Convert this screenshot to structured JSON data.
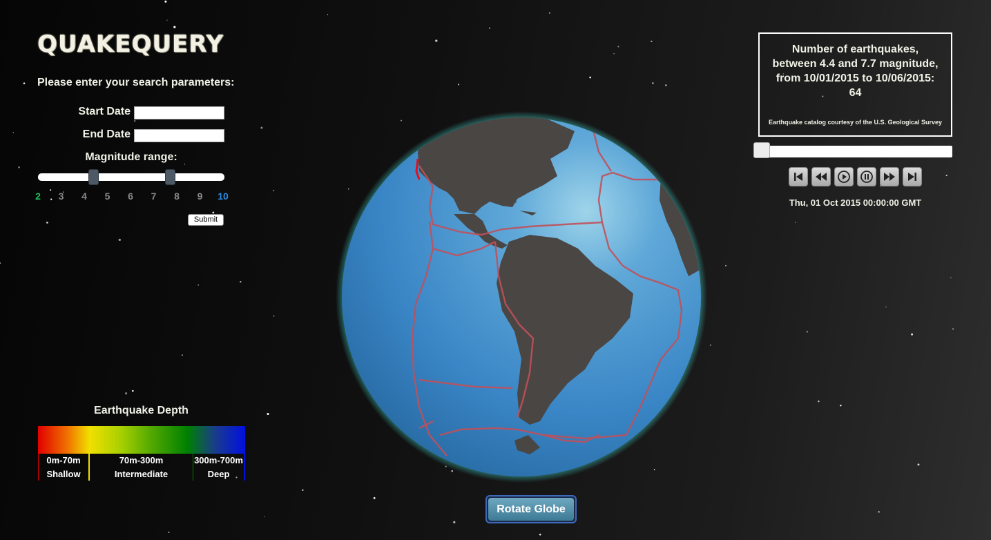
{
  "app": {
    "title": "QUAKEQUERY"
  },
  "search": {
    "prompt": "Please enter your search parameters:",
    "start_label": "Start Date",
    "end_label": "End Date",
    "start_value": "",
    "end_value": "",
    "magnitude_label": "Magnitude range:",
    "magnitude_min": 2,
    "magnitude_max": 10,
    "selected_low": 4.4,
    "selected_high": 7.7,
    "ticks": [
      "2",
      "3",
      "4",
      "5",
      "6",
      "7",
      "8",
      "9",
      "10"
    ],
    "submit_label": "Submit"
  },
  "legend": {
    "title": "Earthquake Depth",
    "segments": [
      {
        "range": "0m-70m",
        "name": "Shallow",
        "color": "#e00000"
      },
      {
        "range": "70m-300m",
        "name": "Intermediate",
        "color": "#f0e000"
      },
      {
        "range": "300m-700m",
        "name": "Deep",
        "color": "#0010e0"
      }
    ]
  },
  "info": {
    "line1": "Number of earthquakes,",
    "line2": "between 4.4 and 7.7 magnitude,",
    "line3": "from 10/01/2015 to 10/06/2015:",
    "count": "64",
    "credit": "Earthquake catalog courtesy of the U.S. Geological Survey"
  },
  "timeline": {
    "position": 0,
    "current_time": "Thu, 01 Oct 2015 00:00:00 GMT",
    "controls": [
      "skip-start-icon",
      "rewind-icon",
      "play-icon",
      "pause-icon",
      "fast-forward-icon",
      "skip-end-icon"
    ]
  },
  "globe": {
    "ocean_color": "#3a86c6",
    "land_color": "#4a4644",
    "plate_color": "#c0505a",
    "glow_color": "#3fd6c8"
  },
  "rotate": {
    "label": "Rotate Globe"
  }
}
